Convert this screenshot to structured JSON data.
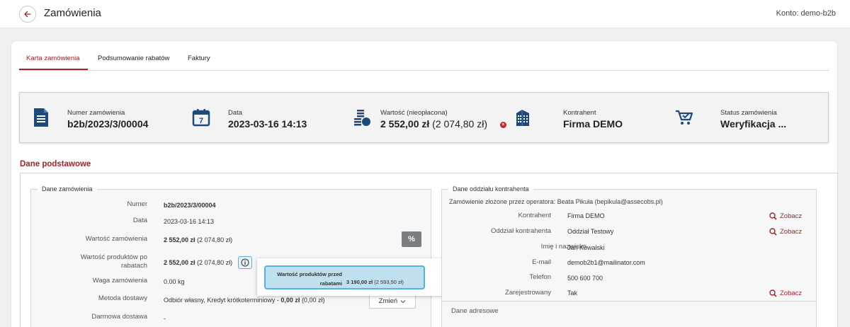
{
  "header": {
    "title": "Zamówienia",
    "account": "Konto: demo-b2b"
  },
  "tabs": [
    {
      "label": "Karta zamówienia",
      "active": true
    },
    {
      "label": "Podsumowanie rabatów",
      "active": false
    },
    {
      "label": "Faktury",
      "active": false
    }
  ],
  "summary": {
    "order_number": {
      "label": "Numer zamówienia",
      "value": "b2b/2023/3/00004"
    },
    "date": {
      "label": "Data",
      "value": "2023-03-16 14:13"
    },
    "value": {
      "label": "Wartość (nieopłacona)",
      "gross": "2 552,00 zł",
      "net": "(2 074,80 zł)"
    },
    "contractor": {
      "label": "Kontrahent",
      "value": "Firma DEMO"
    },
    "status": {
      "label": "Status zamówienia",
      "value": "Weryfikacja ..."
    },
    "calendar_day": "7"
  },
  "section_title": "Dane podstawowe",
  "order_data": {
    "legend": "Dane zamówienia",
    "number": {
      "label": "Numer",
      "value": "b2b/2023/3/00004"
    },
    "date": {
      "label": "Data",
      "value": "2023-03-16 14:13"
    },
    "order_value": {
      "label": "Wartość zamówienia",
      "gross": "2 552,00 zł",
      "net": "(2 074,80 zł)"
    },
    "discounted_value": {
      "label_line1": "Wartość produktów po",
      "label_line2": "rabatach",
      "gross": "2 552,00 zł",
      "net": "(2 074,80 zł)"
    },
    "weight": {
      "label": "Waga zamówienia",
      "value": "0.00 kg"
    },
    "delivery": {
      "label": "Metoda dostawy",
      "value_prefix": "Odbiór własny, Kredyt krótkoterminiowy - ",
      "gross": "0,00 zł",
      "net": "(0,00 zł)"
    },
    "free_delivery": {
      "label": "Darmowa dostawa",
      "value": "-"
    },
    "discount_button": "%",
    "change_button": "Zmień"
  },
  "tooltip": {
    "label_line1": "Wartość produktów przed",
    "label_line2": "rabatami",
    "gross": "3 190,00 zł",
    "net": "(2 593,50 zł)"
  },
  "branch_data": {
    "legend": "Dane oddziału kontrahenta",
    "operator": "Zamówienie złożone przez operatora: Beata Pikuła (bepikula@assecobs.pl)",
    "rows": [
      {
        "label": "Kontrahent",
        "value": "Firma DEMO",
        "link": "Zobacz"
      },
      {
        "label": "Oddział kontrahenta",
        "value": "Oddział Testowy",
        "link": "Zobacz"
      },
      {
        "label": "Imię i nazwisko",
        "value": "Jan Kowalski"
      },
      {
        "label": "E-mail",
        "value": "demob2b1@mailinator.com"
      },
      {
        "label": "Telefon",
        "value": "500 600 700"
      },
      {
        "label": "Zarejestrowany",
        "value": "Tak",
        "link": "Zobacz"
      }
    ],
    "address_title": "Dane adresowe"
  },
  "colors": {
    "accent": "#a4232a",
    "icon_blue": "#1d4a7a",
    "tooltip_border": "#52b4db"
  }
}
